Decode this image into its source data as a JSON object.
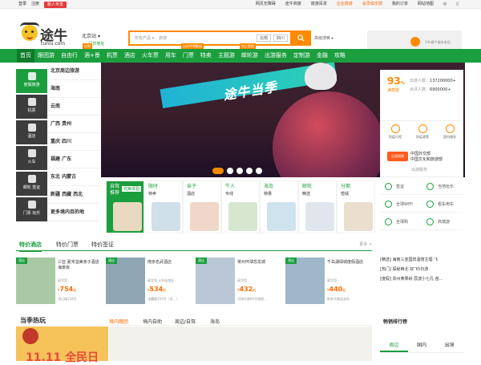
{
  "topbar": {
    "login": "登录",
    "register": "注册",
    "newbie": "新人专享",
    "links": [
      "网页无障碍",
      "途牛商旅",
      "旅游百货",
      "企业旅游",
      "会员俱乐部",
      "我的订单",
      "网站地图"
    ]
  },
  "header": {
    "logo_cn": "途牛",
    "logo_en": "tuniu.com",
    "city": "北京站",
    "city_sub": "门市地址",
    "search_category": "所有产品",
    "search_placeholder": "旅游",
    "search_tags": [
      "云南",
      "四川"
    ],
    "advanced": "高级搜索",
    "phone_text": "24h客户服务电话"
  },
  "nav": {
    "items": [
      {
        "label": "首页",
        "badge": ""
      },
      {
        "label": "跟团游",
        "badge": ""
      },
      {
        "label": "自由行",
        "badge": ""
      },
      {
        "label": "酒+景",
        "badge": "自驾"
      },
      {
        "label": "机票",
        "badge": ""
      },
      {
        "label": "酒店",
        "badge": ""
      },
      {
        "label": "火车票",
        "badge": ""
      },
      {
        "label": "用车",
        "badge": ""
      },
      {
        "label": "门票",
        "badge": "比价环球影城"
      },
      {
        "label": "特卖",
        "badge": ""
      },
      {
        "label": "主题游",
        "badge": ""
      },
      {
        "label": "邮轮游",
        "badge": "海上假期"
      },
      {
        "label": "出游服务",
        "badge": ""
      },
      {
        "label": "定制游",
        "badge": ""
      },
      {
        "label": "金融",
        "badge": ""
      },
      {
        "label": "攻略",
        "badge": ""
      }
    ]
  },
  "sidebar": {
    "icons": [
      "度假旅游",
      "机票",
      "酒店",
      "火车",
      "邮轮 签证",
      "门票 玩乐"
    ],
    "rows": [
      "北京周边旅游",
      "海南",
      "云南",
      "广西  贵州",
      "重庆  四川",
      "福建  广东",
      "东北  内蒙古",
      "新疆  西藏  西北",
      "更多境内目的地"
    ]
  },
  "banner": {
    "title": "途牛当季"
  },
  "member": {
    "satisfaction": "93",
    "sat_unit": "%",
    "sat_label": "满意度",
    "line1_label": "出游人数：",
    "line1_value": "137200000+",
    "line2_label": "点评人数：",
    "line2_value": "6900000+"
  },
  "services": {
    "items": [
      "防疫行程",
      "防疫政策",
      "国内服务"
    ],
    "promo_logo": "出游保障",
    "promo_lines": [
      "中国外交部",
      "中国文化和旅游部"
    ],
    "caption": "出游服务"
  },
  "cards": [
    {
      "title": "自驾推荐",
      "desc": "完美体验"
    },
    {
      "title": "限时",
      "desc": "特卖"
    },
    {
      "title": "亲子",
      "desc": "酒店"
    },
    {
      "title": "牛人",
      "desc": "专线"
    },
    {
      "title": "海岛",
      "desc": "特惠"
    },
    {
      "title": "邮轮",
      "desc": "精选"
    },
    {
      "title": "分期",
      "desc": "借钱"
    }
  ],
  "sidegrid": [
    "签证",
    "当地玩乐",
    "全球WIFI",
    "租车用车",
    "全球购",
    "高端游"
  ],
  "section": {
    "tabs": [
      "特价酒店",
      "特价门票",
      "特价签证"
    ],
    "more": "更多 >"
  },
  "hotels": [
    {
      "label": "酒店",
      "name": "三亚 夏宋溢美亲子酒店海景房",
      "sub": "豪华型",
      "price": "754",
      "addr": "顶山路128号"
    },
    {
      "label": "酒店",
      "name": "南京名武酒店",
      "sub": "豪华型·火车站地区",
      "price": "534",
      "addr": "龙蟠路155号（近...）"
    },
    {
      "label": "酒店",
      "name": "常州环球恐龙城",
      "sub": "豪华型",
      "price": "432",
      "addr": "河海东路60号城就..."
    },
    {
      "label": "酒店",
      "name": "千岛湖绿城度假酒店",
      "sub": "豪华型",
      "price": "440",
      "addr": "新安北路县县码"
    }
  ],
  "news": [
    "[精选] 海南三亚国宾酒馆主理·飞",
    "[热门] 探秘西北 双飞5日游",
    "[度假] 贵州黄果树·荔波小七孔·苗..."
  ],
  "season": {
    "title": "当季热玩",
    "tabs": [
      "境内跟团",
      "境内自助",
      "周边/自驾",
      "海岛"
    ],
    "promo": "11.11 全民日"
  },
  "rank": {
    "title": "畅销排行榜",
    "tabs": [
      "周边",
      "国内",
      "出境"
    ]
  },
  "colors": {
    "brand_green": "#1b9e3e",
    "accent_orange": "#ff8a00",
    "price_orange": "#ff6a00"
  }
}
